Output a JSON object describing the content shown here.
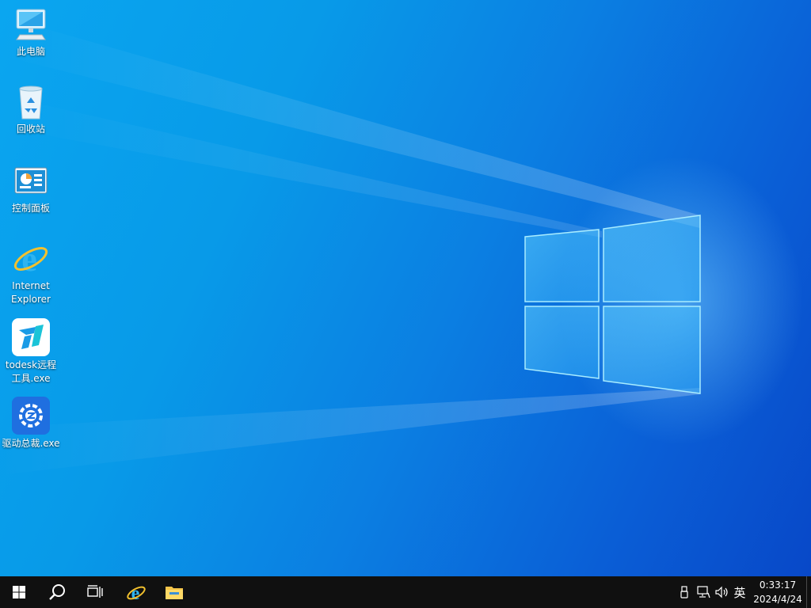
{
  "desktop": {
    "icons": [
      {
        "label_lines": [
          "此电脑"
        ],
        "icon": "this-pc-icon"
      },
      {
        "label_lines": [
          "回收站"
        ],
        "icon": "recycle-bin-icon"
      },
      {
        "label_lines": [
          "控制面板"
        ],
        "icon": "control-panel-icon"
      },
      {
        "label_lines": [
          "Internet",
          "Explorer"
        ],
        "icon": "internet-explorer-icon"
      },
      {
        "label_lines": [
          "todesk远程",
          "工具.exe"
        ],
        "icon": "todesk-icon"
      },
      {
        "label_lines": [
          "驱动总裁.exe"
        ],
        "icon": "driver-tool-icon"
      }
    ]
  },
  "taskbar": {
    "buttons": [
      "windows-start-icon",
      "search-icon",
      "task-view-icon",
      "internet-explorer-icon",
      "file-explorer-icon"
    ],
    "tray": {
      "icons": [
        "usb-icon",
        "network-icon",
        "volume-icon"
      ],
      "language": "英"
    },
    "clock": {
      "time": "0:33:17",
      "date": "2024/4/24"
    }
  },
  "colors": {
    "desktop_accent": "#0a7fe2",
    "taskbar_bg": "#101010",
    "logo_glow": "#7fd8ff"
  }
}
